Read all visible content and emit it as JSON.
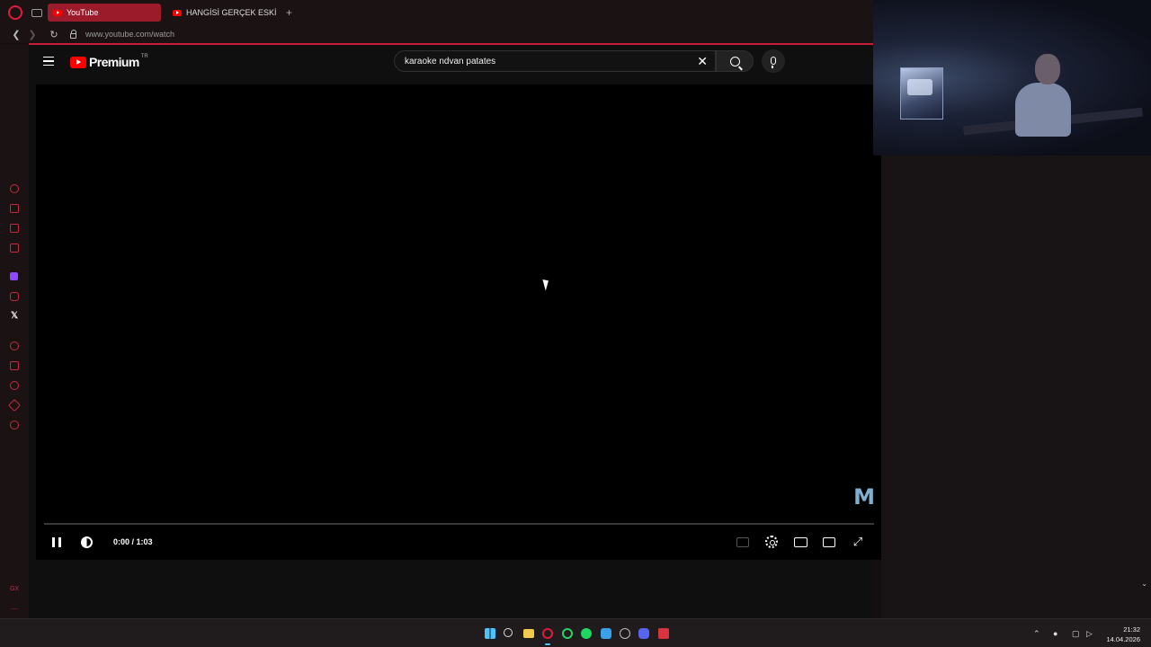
{
  "browser": {
    "tabs": [
      {
        "label": "YouTube",
        "active": true
      },
      {
        "label": "HANGİSİ GERÇEK ESKİ SE",
        "active": false
      }
    ],
    "new_tab_icon": "+",
    "url": "www.youtube.com/watch",
    "accent": "#c81e3a"
  },
  "youtube": {
    "logo_text": "Premium",
    "country_code": "TR",
    "search_value": "karaoke ndvan patates",
    "clear_icon": "✕"
  },
  "player": {
    "watermark": "M",
    "time_current": "0:00",
    "time_separator": " / ",
    "time_total": "1:03",
    "time_display": "0:00 / 1:03",
    "progress": 0,
    "fullscreen_icon": "⤢"
  },
  "sidebar": {
    "x_icon": "𝕏",
    "gx_label": "GX",
    "more_label": "···"
  },
  "taskbar": {
    "time": "21:32",
    "date": "14.04.2026",
    "tray_up_icon": "⌃"
  }
}
